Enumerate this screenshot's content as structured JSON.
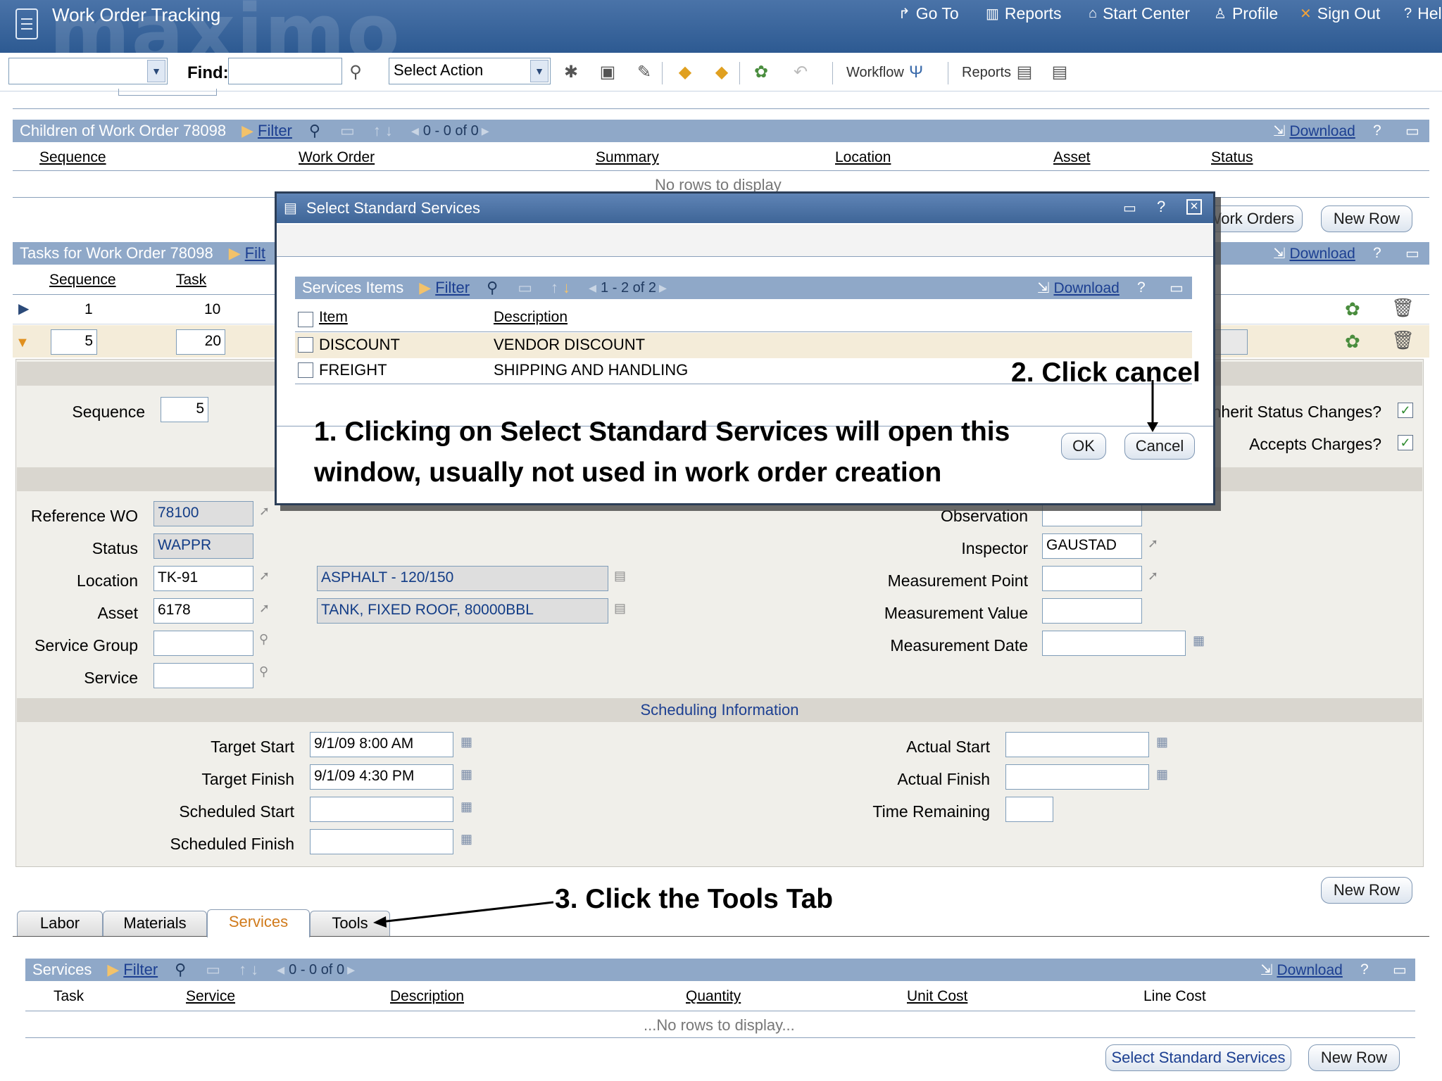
{
  "header": {
    "app_title": "Work Order Tracking",
    "watermark": "maximo",
    "nav": [
      {
        "name": "goto",
        "label": "Go To",
        "icon": "arrow-icon"
      },
      {
        "name": "reports",
        "label": "Reports",
        "icon": "chart-icon"
      },
      {
        "name": "startcenter",
        "label": "Start Center",
        "icon": "home-icon"
      },
      {
        "name": "profile",
        "label": "Profile",
        "icon": "person-icon"
      },
      {
        "name": "signout",
        "label": "Sign Out",
        "icon": "x-icon"
      },
      {
        "name": "help",
        "label": "Hel",
        "icon": "question-icon"
      }
    ]
  },
  "toolbar": {
    "find_label": "Find:",
    "find_value": "",
    "action_select": "Select Action",
    "workflow_label": "Workflow",
    "reports_label": "Reports"
  },
  "children": {
    "title": "Children of Work Order 78098",
    "filter": "Filter",
    "pager": "0 - 0 of 0",
    "download": "Download",
    "columns": [
      "Sequence",
      "Work Order",
      "Summary",
      "Location",
      "Asset",
      "Status"
    ],
    "no_rows": "No rows to display",
    "btn_work_orders": "Work Orders",
    "btn_new_row": "New Row"
  },
  "tasks": {
    "title": "Tasks for Work Order 78098",
    "filter": "Filt",
    "download": "Download",
    "columns": [
      "Sequence",
      "Task"
    ],
    "rows": [
      {
        "sequence": "1",
        "task": "10"
      },
      {
        "sequence": "5",
        "task": "20"
      }
    ]
  },
  "detail": {
    "sequence_label": "Sequence",
    "sequence_value": "5",
    "inherit_label": "Inherit Status Changes?",
    "accepts_label": "Accepts Charges?",
    "inherit_checked": true,
    "accepts_checked": true,
    "refwo_label": "Reference WO",
    "refwo_value": "78100",
    "status_label": "Status",
    "status_value": "WAPPR",
    "location_label": "Location",
    "location_value": "TK-91",
    "location_desc": "ASPHALT - 120/150",
    "asset_label": "Asset",
    "asset_value": "6178",
    "asset_desc": "TANK, FIXED ROOF, 80000BBL",
    "servicegroup_label": "Service Group",
    "servicegroup_value": "",
    "service_label": "Service",
    "service_value": "",
    "observation_label": "Observation",
    "observation_value": "",
    "inspector_label": "Inspector",
    "inspector_value": "GAUSTAD",
    "mpoint_label": "Measurement Point",
    "mpoint_value": "",
    "mvalue_label": "Measurement Value",
    "mvalue_value": "",
    "mdate_label": "Measurement Date",
    "mdate_value": ""
  },
  "scheduling": {
    "title": "Scheduling Information",
    "target_start_label": "Target Start",
    "target_start_value": "9/1/09 8:00 AM",
    "target_finish_label": "Target Finish",
    "target_finish_value": "9/1/09 4:30 PM",
    "sched_start_label": "Scheduled Start",
    "sched_start_value": "",
    "sched_finish_label": "Scheduled Finish",
    "sched_finish_value": "",
    "actual_start_label": "Actual Start",
    "actual_start_value": "",
    "actual_finish_label": "Actual Finish",
    "actual_finish_value": "",
    "time_remaining_label": "Time Remaining",
    "time_remaining_value": "",
    "new_row": "New Row"
  },
  "tabs": {
    "labor": "Labor",
    "materials": "Materials",
    "services": "Services",
    "tools": "Tools",
    "active": "Services"
  },
  "services": {
    "title": "Services",
    "filter": "Filter",
    "pager": "0 - 0 of 0",
    "download": "Download",
    "columns": [
      "Task",
      "Service",
      "Description",
      "Quantity",
      "Unit Cost",
      "Line Cost"
    ],
    "no_rows": "...No rows to display...",
    "btn_select_std": "Select Standard Services",
    "btn_new_row": "New Row"
  },
  "modal": {
    "title": "Select Standard Services",
    "section_title": "Services Items",
    "filter": "Filter",
    "pager": "1 - 2 of 2",
    "download": "Download",
    "col_item": "Item",
    "col_desc": "Description",
    "rows": [
      {
        "item": "DISCOUNT",
        "description": "VENDOR DISCOUNT"
      },
      {
        "item": "FREIGHT",
        "description": "SHIPPING AND HANDLING"
      }
    ],
    "ok": "OK",
    "cancel": "Cancel"
  },
  "annotations": {
    "step1_line1": "1. Clicking on Select Standard Services will open this",
    "step1_line2": "window, usually not used in work order creation",
    "step2": "2. Click cancel",
    "step3": "3. Click the Tools Tab"
  },
  "colors": {
    "banner": "#2d5a92",
    "section_header": "#8fa8c8",
    "active_tab_text": "#d07a1b"
  }
}
